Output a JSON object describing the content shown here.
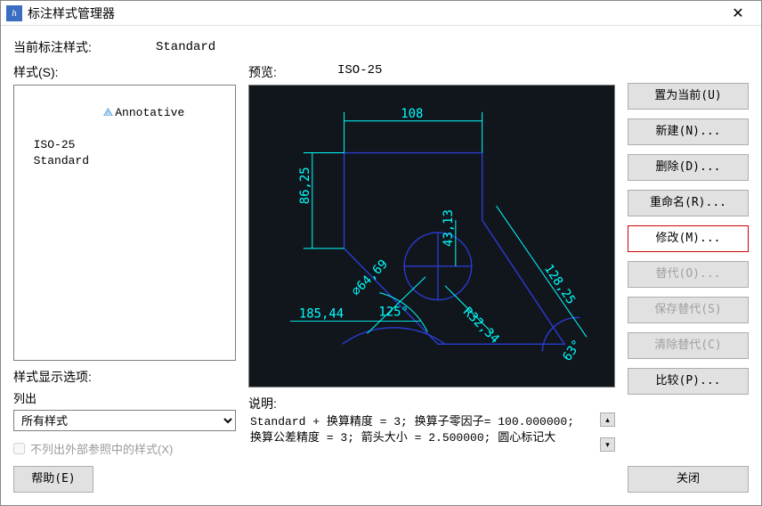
{
  "window": {
    "title": "标注样式管理器",
    "close_glyph": "✕"
  },
  "current_style": {
    "label": "当前标注样式:",
    "value": "Standard"
  },
  "styles_label": "样式(S):",
  "styles_items": {
    "0": {
      "label": "Annotative",
      "is_annotative": true
    },
    "1": {
      "label": "ISO-25",
      "is_annotative": false
    },
    "2": {
      "label": "Standard",
      "is_annotative": false
    }
  },
  "style_display": {
    "label": "样式显示选项:",
    "list_label": "列出",
    "dropdown_value": "所有样式",
    "checkbox_label": "不列出外部参照中的样式(X)"
  },
  "preview": {
    "label": "预览:",
    "name": "ISO-25"
  },
  "buttons": {
    "set_current": "置为当前(U)",
    "new": "新建(N)...",
    "delete": "删除(D)...",
    "rename": "重命名(R)...",
    "modify": "修改(M)...",
    "override": "替代(O)...",
    "save_override": "保存替代(S)",
    "clear_override": "清除替代(C)",
    "compare": "比较(P)...",
    "help": "帮助(E)",
    "close": "关闭"
  },
  "description": {
    "label": "说明:",
    "text": "Standard + 换算精度 = 3; 换算子零因子= 100.000000;\n换算公差精度 = 3; 箭头大小 = 2.500000; 圆心标记大"
  },
  "chart_data": {
    "dims": {
      "top": "108",
      "left_v": "86,25",
      "center_v": "43,13",
      "diag_left": "⌀64,69",
      "angle": "125°",
      "bottom": "185,44",
      "radius": "R32,34",
      "right_diag": "128,25",
      "right_angle": "63°"
    }
  }
}
